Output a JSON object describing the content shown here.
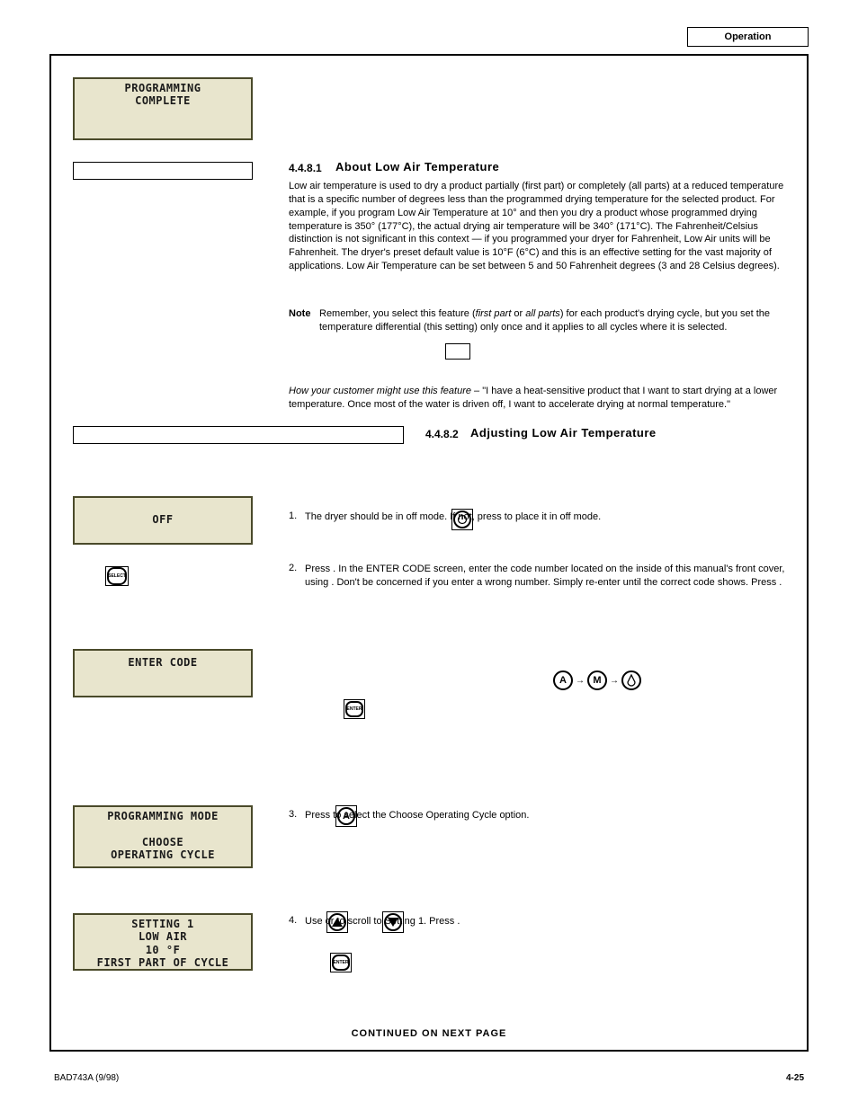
{
  "header": {
    "top_box_label": "Operation",
    "page_number": "4-25"
  },
  "lcd": {
    "prog_complete": "PROGRAMMING\nCOMPLETE",
    "off": "OFF",
    "enter_code": "ENTER CODE",
    "prog_mode": "PROGRAMMING MODE\n\nCHOOSE\nOPERATING CYCLE",
    "setting1": "SETTING 1\nLOW AIR\n10 °F\nFIRST PART OF CYCLE"
  },
  "section": {
    "about_title": "4.4.8.1",
    "about_heading": "About Low Air Temperature",
    "about_text": "Low air temperature is used to dry a product partially (first part) or completely (all parts) at a reduced temperature that is a specific number of degrees less than the programmed drying temperature for the selected product. For example, if you program Low Air Temperature at 10° and then you dry a product whose programmed drying temperature is 350° (177°C), the actual drying air temperature will be 340° (171°C). The Fahrenheit/Celsius distinction is not significant in this context — if you programmed your dryer for Fahrenheit, Low Air units will be Fahrenheit. The dryer's preset default value is 10°F (6°C) and this is an effective setting for the vast majority of applications. Low Air Temperature can be set between 5 and 50 Fahrenheit degrees (3 and 28 Celsius degrees).",
    "note_label": "Note",
    "note_text": "Remember, you select this feature (          or            ) for each product's drying cycle, but you set the temperature differential (this setting) only once and it applies to all cycles where it is selected.",
    "note_first": "first part",
    "note_all": "all parts",
    "tip_text": "How your customer might use this feature – ",
    "tip_body": "\"I have a heat-sensitive product that I want to start drying at a lower temperature. Once most of the water is driven off, I want to accelerate drying at normal temperature.\"",
    "adjust_code": "4.4.8.2",
    "adjust_title": "Adjusting Low Air Temperature"
  },
  "steps": {
    "s1_num": "1.",
    "s1_text": "The dryer should be in off mode. If not, press           to place it in off mode.",
    "s2_num": "2.",
    "s2_text": "Press        . In the ENTER CODE screen, enter the code number located on the inside of this manual's front cover, using                       . Don't be concerned if you enter a wrong number. Simply re-enter until the correct code shows. Press        .",
    "s3_num": "3.",
    "s3_text": "Press        to select the Choose Operating Cycle option.",
    "s4_num": "4.",
    "s4_text": "Use        or        to scroll to Setting 1. Press            ."
  },
  "continued": "CONTINUED ON NEXT PAGE",
  "footer": "BAD743A (9/98)",
  "icons": {
    "on_off": "on-off-icon",
    "select": "SELECT",
    "enter": "ENTER",
    "a": "A",
    "m": "M",
    "drop": "drop"
  }
}
